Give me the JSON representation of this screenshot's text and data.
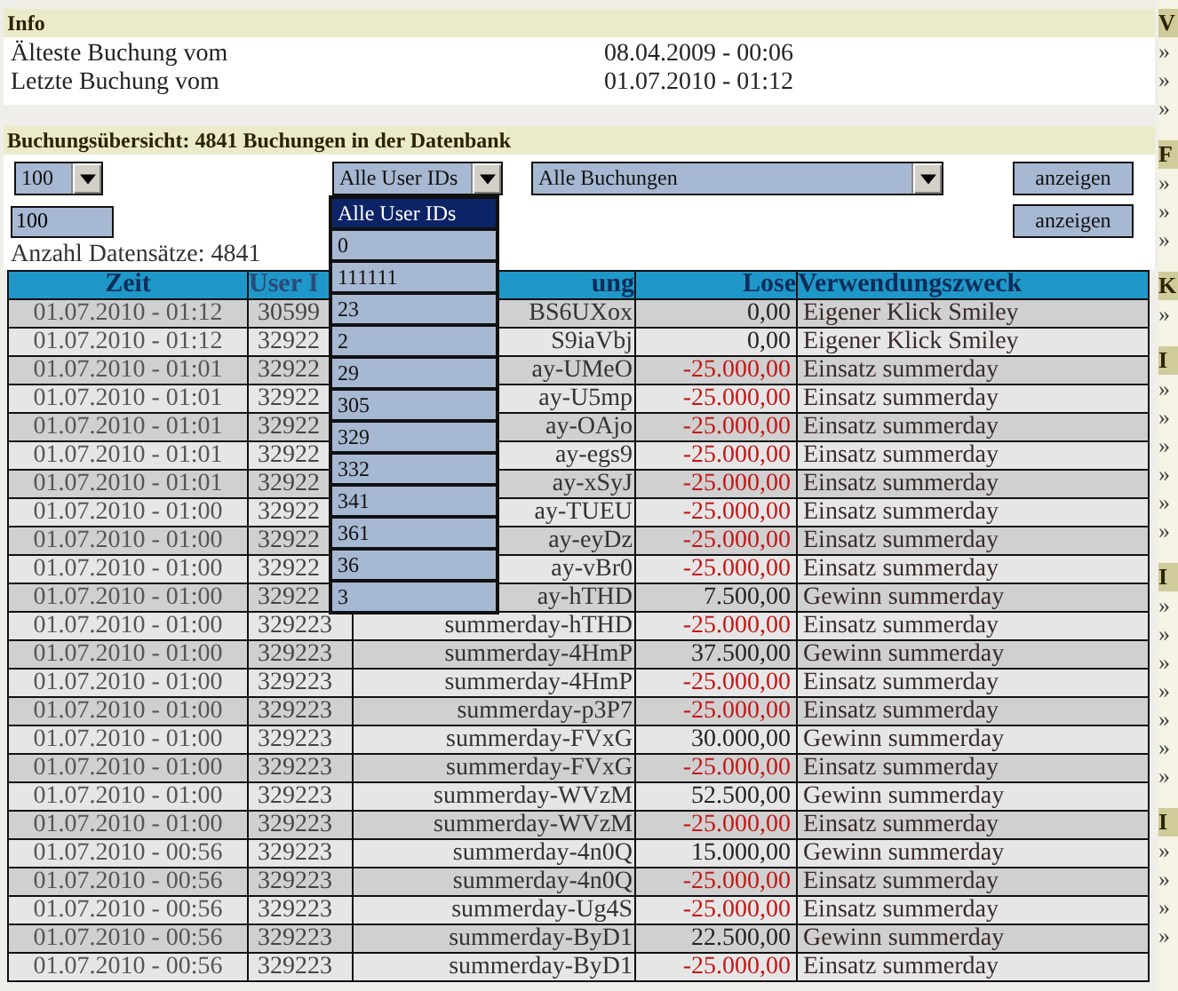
{
  "info": {
    "title": "Info",
    "rows": [
      {
        "label": "Älteste Buchung vom",
        "value": "08.04.2009 - 00:06"
      },
      {
        "label": "Letzte Buchung vom",
        "value": "01.07.2010 - 01:12"
      }
    ]
  },
  "overview": {
    "title": "Buchungsübersicht: 4841 Buchungen in der Datenbank",
    "page_size_select": "100",
    "user_select": {
      "value": "Alle User IDs",
      "expanded": true,
      "options": [
        {
          "label": "Alle User IDs",
          "selected": true
        },
        {
          "label": "0",
          "selected": false
        },
        {
          "label": "111111",
          "selected": false
        },
        {
          "label": "23",
          "selected": false
        },
        {
          "label": "2",
          "selected": false
        },
        {
          "label": "29",
          "selected": false
        },
        {
          "label": "305",
          "selected": false
        },
        {
          "label": "329",
          "selected": false
        },
        {
          "label": "332",
          "selected": false
        },
        {
          "label": "341",
          "selected": false
        },
        {
          "label": "361",
          "selected": false
        },
        {
          "label": "36",
          "selected": false
        },
        {
          "label": "3",
          "selected": false
        }
      ]
    },
    "type_select": "Alle Buchungen",
    "input_value": "100",
    "buttons": [
      "anzeigen",
      "anzeigen"
    ],
    "count": "Anzahl Datensätze: 4841",
    "table": {
      "columns": [
        "Zeit",
        "User I",
        "ung",
        "Lose",
        "Verwendungszweck"
      ],
      "rows": [
        {
          "kind": "credit",
          "cells": [
            "01.07.2010 - 01:12",
            "30599",
            "BS6UXox",
            "0,00",
            "Eigener Klick Smiley"
          ]
        },
        {
          "kind": "credit",
          "cells": [
            "01.07.2010 - 01:12",
            "32922",
            "S9iaVbj",
            "0,00",
            "Eigener Klick Smiley"
          ]
        },
        {
          "kind": "debit",
          "cells": [
            "01.07.2010 - 01:01",
            "32922",
            "ay-UMeO",
            "-25.000,00",
            "Einsatz summerday"
          ]
        },
        {
          "kind": "debit",
          "cells": [
            "01.07.2010 - 01:01",
            "32922",
            "ay-U5mp",
            "-25.000,00",
            "Einsatz summerday"
          ]
        },
        {
          "kind": "debit",
          "cells": [
            "01.07.2010 - 01:01",
            "32922",
            "ay-OAjo",
            "-25.000,00",
            "Einsatz summerday"
          ]
        },
        {
          "kind": "debit",
          "cells": [
            "01.07.2010 - 01:01",
            "32922",
            "ay-egs9",
            "-25.000,00",
            "Einsatz summerday"
          ]
        },
        {
          "kind": "debit",
          "cells": [
            "01.07.2010 - 01:01",
            "32922",
            "ay-xSyJ",
            "-25.000,00",
            "Einsatz summerday"
          ]
        },
        {
          "kind": "debit",
          "cells": [
            "01.07.2010 - 01:00",
            "32922",
            "ay-TUEU",
            "-25.000,00",
            "Einsatz summerday"
          ]
        },
        {
          "kind": "debit",
          "cells": [
            "01.07.2010 - 01:00",
            "32922",
            "ay-eyDz",
            "-25.000,00",
            "Einsatz summerday"
          ]
        },
        {
          "kind": "debit",
          "cells": [
            "01.07.2010 - 01:00",
            "32922",
            "ay-vBr0",
            "-25.000,00",
            "Einsatz summerday"
          ]
        },
        {
          "kind": "credit",
          "cells": [
            "01.07.2010 - 01:00",
            "32922",
            "ay-hTHD",
            "7.500,00",
            "Gewinn summerday"
          ]
        },
        {
          "kind": "debit",
          "cells": [
            "01.07.2010 - 01:00",
            "329223",
            "summerday-hTHD",
            "-25.000,00",
            "Einsatz summerday"
          ]
        },
        {
          "kind": "credit",
          "cells": [
            "01.07.2010 - 01:00",
            "329223",
            "summerday-4HmP",
            "37.500,00",
            "Gewinn summerday"
          ]
        },
        {
          "kind": "debit",
          "cells": [
            "01.07.2010 - 01:00",
            "329223",
            "summerday-4HmP",
            "-25.000,00",
            "Einsatz summerday"
          ]
        },
        {
          "kind": "debit",
          "cells": [
            "01.07.2010 - 01:00",
            "329223",
            "summerday-p3P7",
            "-25.000,00",
            "Einsatz summerday"
          ]
        },
        {
          "kind": "credit",
          "cells": [
            "01.07.2010 - 01:00",
            "329223",
            "summerday-FVxG",
            "30.000,00",
            "Gewinn summerday"
          ]
        },
        {
          "kind": "debit",
          "cells": [
            "01.07.2010 - 01:00",
            "329223",
            "summerday-FVxG",
            "-25.000,00",
            "Einsatz summerday"
          ]
        },
        {
          "kind": "credit",
          "cells": [
            "01.07.2010 - 01:00",
            "329223",
            "summerday-WVzM",
            "52.500,00",
            "Gewinn summerday"
          ]
        },
        {
          "kind": "debit",
          "cells": [
            "01.07.2010 - 01:00",
            "329223",
            "summerday-WVzM",
            "-25.000,00",
            "Einsatz summerday"
          ]
        },
        {
          "kind": "credit",
          "cells": [
            "01.07.2010 - 00:56",
            "329223",
            "summerday-4n0Q",
            "15.000,00",
            "Gewinn summerday"
          ]
        },
        {
          "kind": "debit",
          "cells": [
            "01.07.2010 - 00:56",
            "329223",
            "summerday-4n0Q",
            "-25.000,00",
            "Einsatz summerday"
          ]
        },
        {
          "kind": "debit",
          "cells": [
            "01.07.2010 - 00:56",
            "329223",
            "summerday-Ug4S",
            "-25.000,00",
            "Einsatz summerday"
          ]
        },
        {
          "kind": "credit",
          "cells": [
            "01.07.2010 - 00:56",
            "329223",
            "summerday-ByD1",
            "22.500,00",
            "Gewinn summerday"
          ]
        },
        {
          "kind": "debit",
          "cells": [
            "01.07.2010 - 00:56",
            "329223",
            "summerday-ByD1",
            "-25.000,00",
            "Einsatz summerday"
          ]
        }
      ]
    }
  },
  "sidebar": {
    "groups": [
      {
        "heading": "V",
        "links": [
          "»",
          "»",
          "»"
        ]
      },
      {
        "heading": "F",
        "links": [
          "»",
          "»",
          "»"
        ]
      },
      {
        "heading": "K",
        "links": [
          "»"
        ]
      },
      {
        "heading": "I",
        "links": [
          "»",
          "»",
          "»",
          "»",
          "»",
          "»"
        ]
      },
      {
        "heading": "I",
        "links": [
          "»",
          "»",
          "»",
          "»",
          "»",
          "»",
          "»"
        ]
      },
      {
        "heading": "I",
        "links": [
          "»",
          "»",
          "»",
          "»"
        ]
      }
    ]
  }
}
